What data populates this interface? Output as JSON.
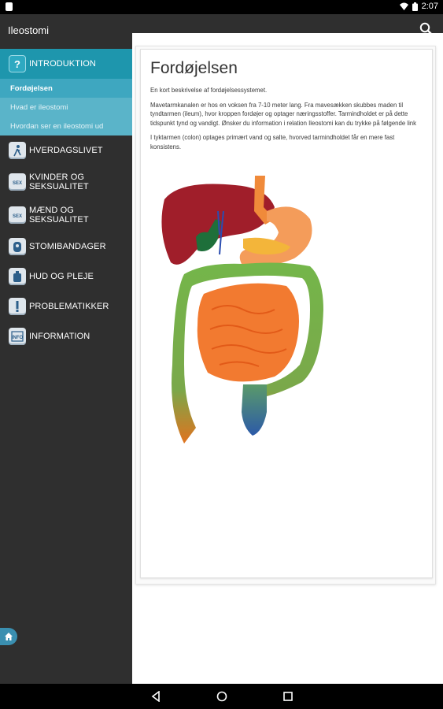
{
  "status_bar": {
    "time": "2:07"
  },
  "app_bar": {
    "title": "Ileostomi",
    "search_icon": "search-icon"
  },
  "sidebar": {
    "sections": [
      {
        "label": "INTRODUKTION",
        "icon": "question-icon",
        "active": true,
        "subitems": [
          {
            "label": "Fordøjelsen",
            "current": true
          },
          {
            "label": "Hvad er ileostomi",
            "current": false
          },
          {
            "label": "Hvordan ser en ileostomi ud",
            "current": false
          }
        ]
      },
      {
        "label": "HVERDAGSLIVET",
        "icon": "person-icon"
      },
      {
        "label": "KVINDER OG SEKSUALITET",
        "icon": "sex-icon"
      },
      {
        "label": "MÆND OG SEKSUALITET",
        "icon": "sex-icon"
      },
      {
        "label": "STOMIBANDAGER",
        "icon": "bag-icon"
      },
      {
        "label": "HUD OG PLEJE",
        "icon": "bottle-icon"
      },
      {
        "label": "PROBLEMATIKKER",
        "icon": "exclamation-icon"
      },
      {
        "label": "INFORMATION",
        "icon": "info-icon"
      }
    ],
    "home_icon": "home-icon"
  },
  "article": {
    "title": "Fordøjelsen",
    "intro": "En kort beskrivelse af fordøjelsessystemet.",
    "paragraph1": "Mavetarmkanalen er hos en voksen fra 7-10 meter lang. Fra mavesækken skubbes maden til tyndtarmen (ileum), hvor kroppen fordøjer og optager næringsstoffer. Tarmindholdet er på dette tidspunkt tynd og vandigt. Ønsker du information i relation Ileostomi kan du trykke på følgende link",
    "paragraph2": "I tyktarmen (colon) optages primært vand og salte, hvorved tarmindholdet får en mere fast konsistens.",
    "illustration": "digestive-system-illustration"
  },
  "nav_bar": {
    "back": "back-icon",
    "home": "home-circle-icon",
    "recents": "recents-icon"
  },
  "colors": {
    "accent": "#1e96ad",
    "sub_bg": "#5ab4c9",
    "sidebar_bg": "#2f2f2f"
  }
}
